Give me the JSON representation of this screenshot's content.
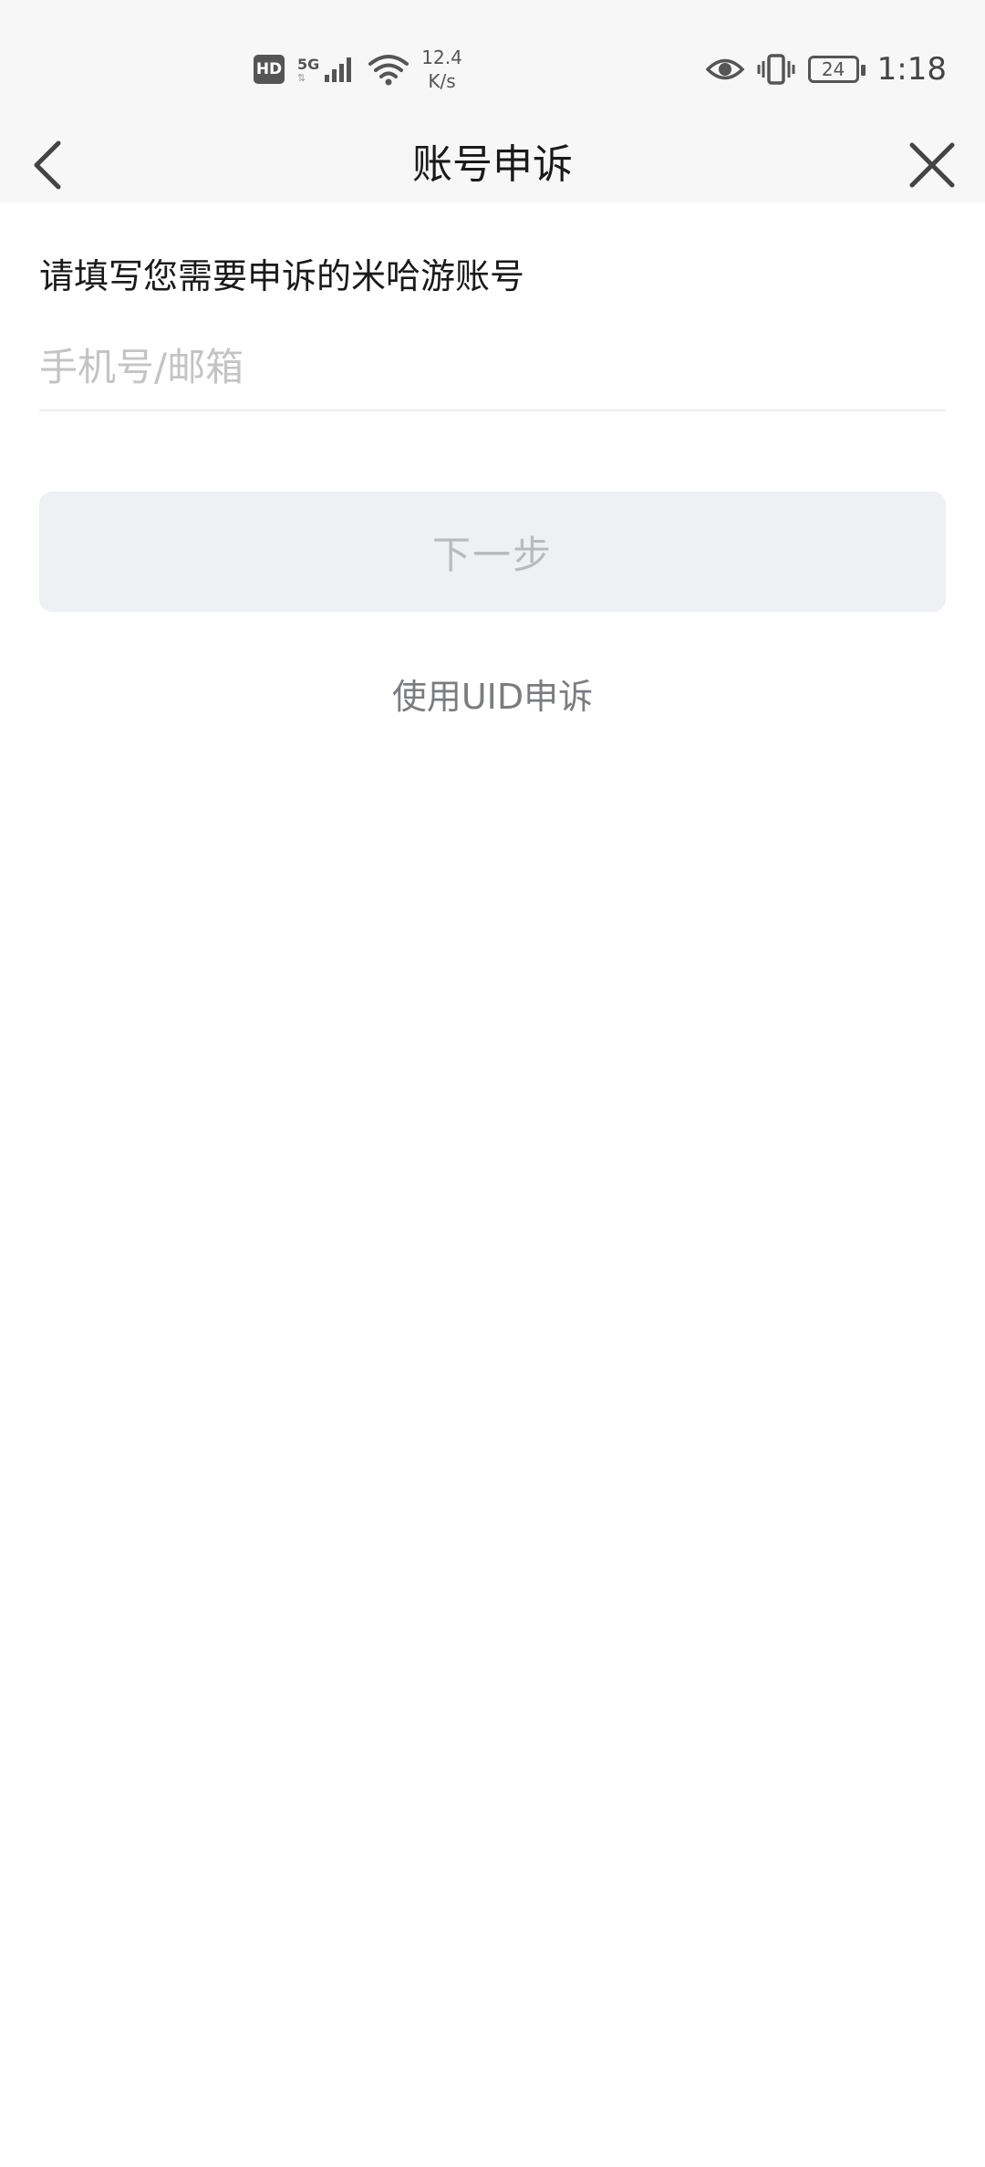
{
  "status_bar": {
    "hd_label": "HD",
    "network_label": "5G",
    "speed_value": "12.4",
    "speed_unit": "K/s",
    "battery_level": "24",
    "time": "1:18",
    "icons": [
      "hd-icon",
      "signal-icon",
      "wifi-icon",
      "eye-icon",
      "vibrate-icon",
      "battery-icon"
    ]
  },
  "header": {
    "title": "账号申诉",
    "back_icon": "chevron-left-icon",
    "close_icon": "close-icon"
  },
  "form": {
    "prompt": "请填写您需要申诉的米哈游账号",
    "account_input": {
      "value": "",
      "placeholder": "手机号/邮箱"
    },
    "next_button_label": "下一步",
    "uid_link_label": "使用UID申诉"
  },
  "colors": {
    "background": "#ffffff",
    "bar_background": "#f7f7f7",
    "disabled_button_bg": "#eff0f3",
    "disabled_button_text": "#b9babd",
    "placeholder_text": "#c4c4c4",
    "link_text": "#7b7c80"
  }
}
